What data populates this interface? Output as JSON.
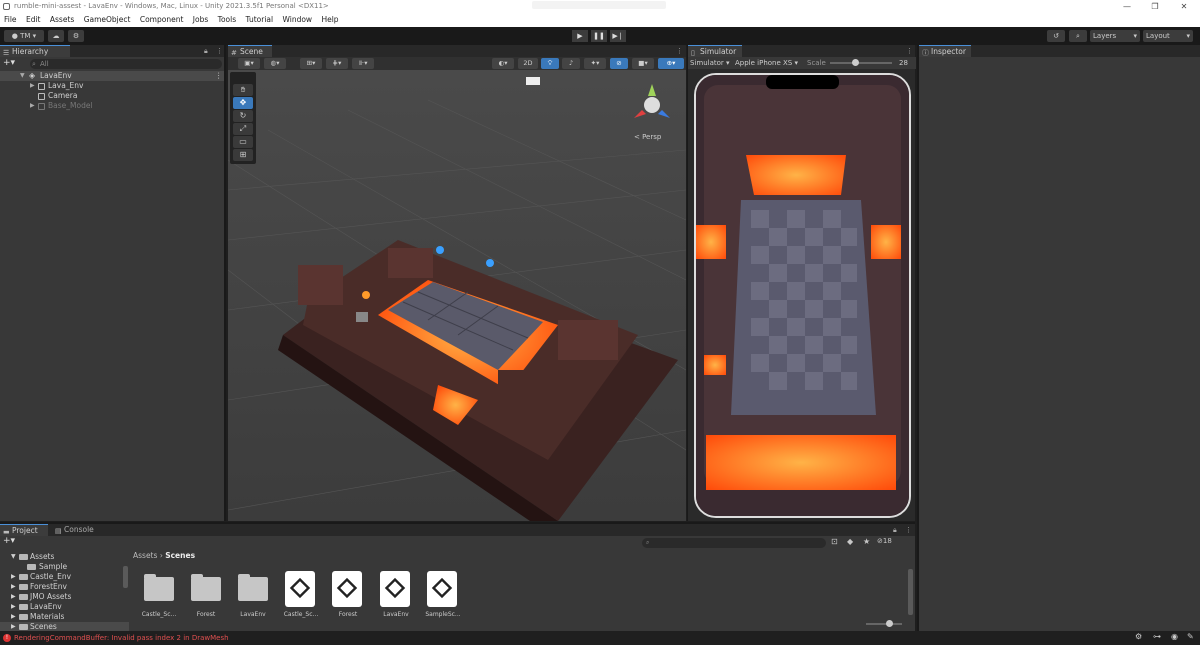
{
  "window": {
    "title": "rumble-mini-assest - LavaEnv - Windows, Mac, Linux - Unity 2021.3.5f1 Personal <DX11>",
    "controls": [
      "—",
      "❐",
      "✕"
    ]
  },
  "menu": [
    "File",
    "Edit",
    "Assets",
    "GameObject",
    "Component",
    "Jobs",
    "Tools",
    "Tutorial",
    "Window",
    "Help"
  ],
  "toolbar": {
    "account": "TM ▾",
    "search_icon": "search-icon",
    "layers": "Layers",
    "layout": "Layout"
  },
  "hierarchy": {
    "tab": "Hierarchy",
    "search_placeholder": "All",
    "items": [
      {
        "name": "LavaEnv",
        "level": 0,
        "selected": true
      },
      {
        "name": "Lava_Env",
        "level": 1
      },
      {
        "name": "Camera",
        "level": 1
      },
      {
        "name": "Base_Model",
        "level": 1,
        "disabled": true
      }
    ]
  },
  "scene": {
    "tab": "Scene",
    "mode_2d": "2D",
    "persp_label": "< Persp"
  },
  "simulator": {
    "tab": "Simulator",
    "mode": "Simulator",
    "device": "Apple iPhone XS",
    "scale_label": "Scale",
    "scale_value": "28",
    "scale_fraction": 0.4
  },
  "inspector": {
    "tab": "Inspector"
  },
  "project": {
    "tab_project": "Project",
    "tab_console": "Console",
    "hidden_count": "18",
    "breadcrumb": [
      "Assets",
      "Scenes"
    ],
    "tree": [
      {
        "name": "Assets",
        "level": 0
      },
      {
        "name": "Sample",
        "level": 1
      },
      {
        "name": "Castle_Env",
        "level": 1
      },
      {
        "name": "ForestEnv",
        "level": 1
      },
      {
        "name": "JMO Assets",
        "level": 1
      },
      {
        "name": "LavaEnv",
        "level": 1
      },
      {
        "name": "Materials",
        "level": 1
      },
      {
        "name": "Scenes",
        "level": 1,
        "selected": true
      }
    ],
    "assets": [
      {
        "name": "Castle_Sc...",
        "kind": "folder"
      },
      {
        "name": "Forest",
        "kind": "folder"
      },
      {
        "name": "LavaEnv",
        "kind": "folder"
      },
      {
        "name": "Castle_Sc...",
        "kind": "scene"
      },
      {
        "name": "Forest",
        "kind": "scene"
      },
      {
        "name": "LavaEnv",
        "kind": "scene"
      },
      {
        "name": "SampleSc...",
        "kind": "scene"
      }
    ]
  },
  "status": {
    "message": "RenderingCommandBuffer: Invalid pass index 2 in DrawMesh"
  }
}
